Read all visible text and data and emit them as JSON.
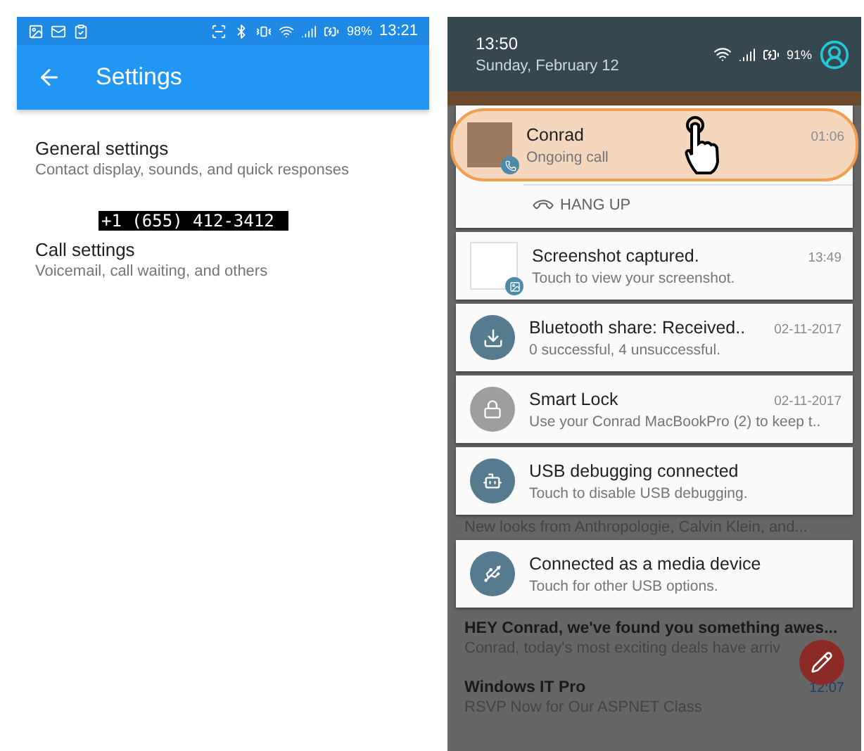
{
  "left": {
    "status_bar": {
      "battery": "98%",
      "time": "13:21"
    },
    "app_bar": {
      "title": "Settings"
    },
    "items": [
      {
        "title": "General settings",
        "subtitle": "Contact display, sounds, and quick responses"
      },
      {
        "title": "Call settings",
        "subtitle": "Voicemail, call waiting, and others"
      }
    ],
    "phone_label": "+1 (655) 412-3412"
  },
  "right": {
    "header": {
      "time": "13:50",
      "date": "Sunday, February 12",
      "battery": "91%"
    },
    "shade_items": [
      {
        "kind": "call",
        "title": "Conrad",
        "text": "Ongoing call",
        "time": "01:06",
        "highlighted": true,
        "action": "HANG UP"
      },
      {
        "kind": "screenshot",
        "title": "Screenshot captured.",
        "text": "Touch to view your screenshot.",
        "time": "13:49",
        "highlighted": false
      },
      {
        "kind": "download",
        "title": "Bluetooth share: Received..",
        "text": "0 successful, 4 unsuccessful.",
        "time": "02-11-2017",
        "highlighted": false
      },
      {
        "kind": "lock",
        "title": "Smart Lock",
        "text": "Use your Conrad MacBookPro (2) to keep t..",
        "time": "02-11-2017",
        "highlighted": false
      },
      {
        "kind": "android",
        "title": "USB debugging connected",
        "text": "Touch to disable USB debugging.",
        "highlighted": false
      },
      {
        "kind": "snippet",
        "text": "New looks from Anthropologie, Calvin Klein, and..."
      },
      {
        "kind": "usb",
        "title": "Connected as a media device",
        "text": "Touch for other USB options.",
        "highlighted": false
      }
    ],
    "inbox": [
      {
        "sender": "HEY Conrad, we've found you something awes...",
        "preview": "Conrad, today's most exciting deals have arriv"
      },
      {
        "sender": "Windows IT Pro",
        "time": "12:07",
        "preview": "RSVP Now for Our ASPNET Class"
      }
    ]
  }
}
